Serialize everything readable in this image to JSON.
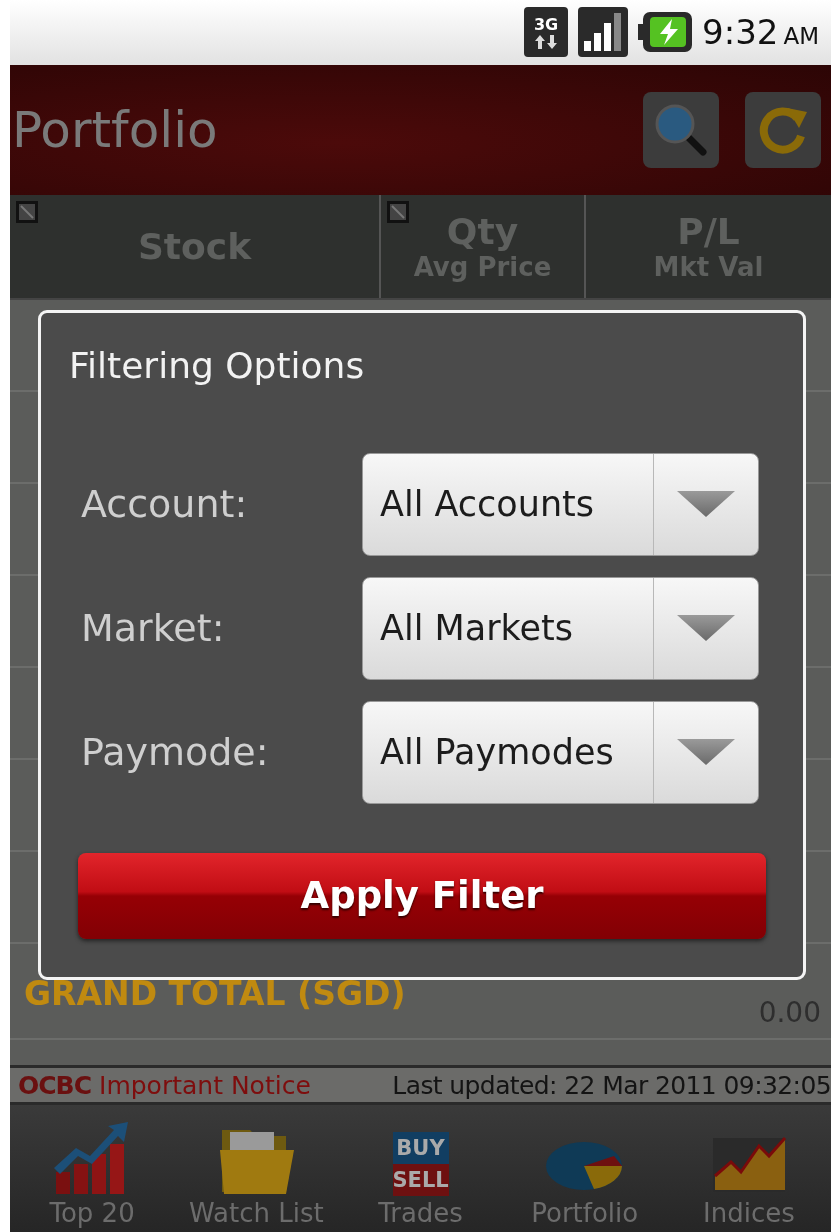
{
  "status_bar": {
    "network": "3G",
    "time": "9:32",
    "ampm": "AM"
  },
  "header": {
    "title": "Portfolio"
  },
  "table": {
    "columns": [
      {
        "label": "Stock",
        "sortable": true
      },
      {
        "label": "Qty",
        "sublabel": "Avg Price",
        "sortable": true
      },
      {
        "label": "P/L",
        "sublabel": "Mkt Val",
        "sortable": false
      }
    ],
    "rows": [
      {
        "kind": "total",
        "name": "GRAND TOTAL (SGD)",
        "value": "0.00"
      }
    ]
  },
  "dialog": {
    "title": "Filtering Options",
    "fields": [
      {
        "label": "Account:",
        "value": "All Accounts"
      },
      {
        "label": "Market:",
        "value": "All Markets"
      },
      {
        "label": "Paymode:",
        "value": "All Paymodes"
      }
    ],
    "button": "Apply Filter"
  },
  "notice": {
    "logo": "OCBC",
    "link": "Important Notice",
    "updated": "Last updated: 22 Mar 2011 09:32:05"
  },
  "tabs": [
    {
      "label": "Top 20"
    },
    {
      "label": "Watch List"
    },
    {
      "label": "Trades",
      "icon_text": [
        "BUY",
        "SELL"
      ]
    },
    {
      "label": "Portfolio"
    },
    {
      "label": "Indices"
    }
  ]
}
